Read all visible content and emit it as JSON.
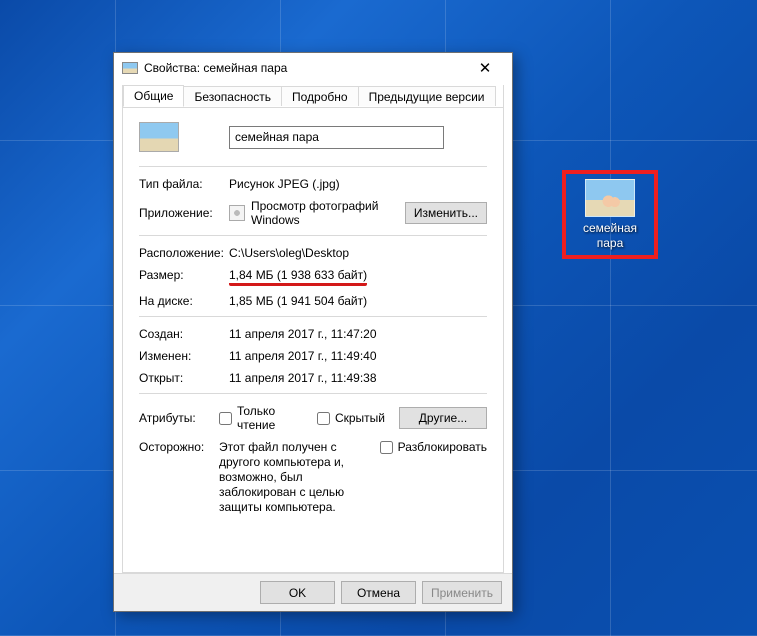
{
  "desktop_icon": {
    "label": "семейная пара"
  },
  "dialog": {
    "title": "Свойства: семейная пара",
    "tabs": [
      "Общие",
      "Безопасность",
      "Подробно",
      "Предыдущие версии"
    ],
    "filename": "семейная пара",
    "labels": {
      "file_type": "Тип файла:",
      "app": "Приложение:",
      "location": "Расположение:",
      "size": "Размер:",
      "size_on_disk": "На диске:",
      "created": "Создан:",
      "modified": "Изменен:",
      "accessed": "Открыт:",
      "attributes": "Атрибуты:",
      "caution": "Осторожно:"
    },
    "values": {
      "file_type": "Рисунок JPEG (.jpg)",
      "app": "Просмотр фотографий Windows",
      "location": "C:\\Users\\oleg\\Desktop",
      "size": "1,84 МБ (1 938 633 байт)",
      "size_on_disk": "1,85 МБ (1 941 504 байт)",
      "created": "11 апреля 2017 г., 11:47:20",
      "modified": "11 апреля 2017 г., 11:49:40",
      "accessed": "11 апреля 2017 г., 11:49:38",
      "readonly": "Только чтение",
      "hidden": "Скрытый",
      "caution_text": "Этот файл получен с другого компьютера и, возможно, был заблокирован с целью защиты компьютера.",
      "unblock": "Разблокировать"
    },
    "buttons": {
      "change": "Изменить...",
      "other": "Другие...",
      "ok": "OK",
      "cancel": "Отмена",
      "apply": "Применить"
    }
  }
}
